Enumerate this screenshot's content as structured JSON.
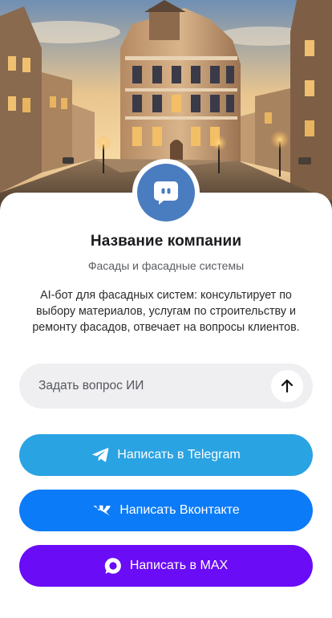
{
  "hero": {
    "image_subject": "street-facade-photo"
  },
  "company": {
    "name": "Название компании",
    "subtitle": "Фасады и фасадные системы",
    "description": "AI-бот для фасадных систем: консультирует по выбору материалов, услугам по строительству и ремонту фасадов, отвечает на вопросы клиентов."
  },
  "ask": {
    "placeholder": "Задать вопрос ИИ",
    "value": ""
  },
  "buttons": {
    "telegram": {
      "label": "Написать в Telegram",
      "color": "#2aa3e3",
      "icon": "telegram-icon"
    },
    "vk": {
      "label": "Написать Вконтакте",
      "color": "#0c7bf8",
      "icon": "vk-icon"
    },
    "max": {
      "label": "Написать в MAX",
      "color": "#6a0cf5",
      "icon": "max-icon"
    }
  },
  "colors": {
    "avatar": "#4a7cc0",
    "ask_bg": "#efeff1"
  }
}
